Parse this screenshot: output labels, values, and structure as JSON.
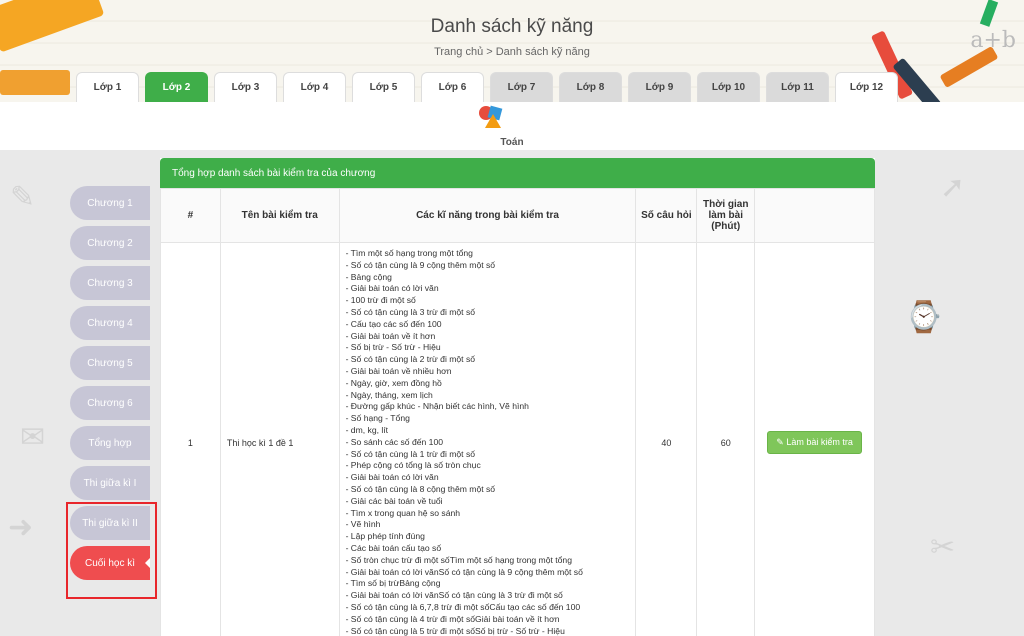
{
  "header": {
    "title": "Danh sách kỹ năng",
    "breadcrumb": "Trang chủ > Danh sách kỹ năng",
    "deco_text": "a+b"
  },
  "grades": [
    {
      "label": "Lớp 1",
      "style": "white"
    },
    {
      "label": "Lớp 2",
      "style": "active"
    },
    {
      "label": "Lớp 3",
      "style": "white"
    },
    {
      "label": "Lớp 4",
      "style": "white"
    },
    {
      "label": "Lớp 5",
      "style": "white"
    },
    {
      "label": "Lớp 6",
      "style": "white"
    },
    {
      "label": "Lớp 7",
      "style": "grey"
    },
    {
      "label": "Lớp 8",
      "style": "grey"
    },
    {
      "label": "Lớp 9",
      "style": "grey"
    },
    {
      "label": "Lớp 10",
      "style": "grey"
    },
    {
      "label": "Lớp 11",
      "style": "grey"
    },
    {
      "label": "Lớp 12",
      "style": "white"
    }
  ],
  "subject": {
    "label": "Toán",
    "icon": "shapes-icon"
  },
  "side_menu": [
    {
      "label": "Chương 1"
    },
    {
      "label": "Chương 2"
    },
    {
      "label": "Chương 3"
    },
    {
      "label": "Chương 4"
    },
    {
      "label": "Chương 5"
    },
    {
      "label": "Chương 6"
    },
    {
      "label": "Tổng hợp"
    },
    {
      "label": "Thi giữa kì I"
    },
    {
      "label": "Thi giữa kì II"
    },
    {
      "label": "Cuối học kì",
      "active": true
    }
  ],
  "panel": {
    "title": "Tổng hợp danh sách bài kiểm tra của chương",
    "columns": [
      "#",
      "Tên bài kiểm tra",
      "Các kĩ năng trong bài kiểm tra",
      "Số câu hỏi",
      "Thời gian làm bài (Phút)",
      ""
    ],
    "rows": [
      {
        "index": "1",
        "name": "Thi học kì 1 đề 1",
        "question_count": "40",
        "duration": "60",
        "action_label": "Làm bài kiểm tra",
        "skills": [
          "- Tìm một số hạng trong một tổng",
          "- Số có tận cùng là 9 cộng thêm một số",
          "- Bảng cộng",
          "- Giải bài toán có lời văn",
          "- 100 trừ đi một số",
          "- Số có tận cùng là 3 trừ đi một số",
          "- Cấu tạo các số đến 100",
          "- Giải bài toán về ít hơn",
          "- Số bị trừ - Số trừ - Hiệu",
          "- Số có tận cùng là 2 trừ đi một số",
          "- Giải bài toán về nhiều hơn",
          "- Ngày, giờ, xem đồng hồ",
          "- Ngày, tháng, xem lịch",
          "- Đường gấp khúc - Nhận biết các hình, Vẽ hình",
          "- Số hạng - Tổng",
          "- dm, kg, lít",
          "- So sánh các số đến 100",
          "- Số có tận cùng là 1 trừ đi một số",
          "- Phép cộng có tổng là số tròn chục",
          "- Giải bài toán có lời văn",
          "- Số có tận cùng là 8 cộng thêm một số",
          "- Giải các bài toán về tuổi",
          "- Tìm x trong quan hệ so sánh",
          "- Vẽ hình",
          "- Lập phép tính đúng",
          "- Các bài toán cấu tạo số",
          "- Số tròn chục trừ đi một sốTìm một số hạng trong một tổng",
          "- Giải bài toán có lời vănSố có tận cùng là 9 cộng thêm một số",
          "- Tìm số bị trừBảng cộng",
          "- Giải bài toán có lời vănSố có tận cùng là 3 trừ đi một số",
          "- Số có tận cùng là 6,7,8 trừ đi một sốCấu tạo các số đến 100",
          "- Số có tận cùng là 4 trừ đi một sốGiải bài toán về ít hơn",
          "- Số có tận cùng là 5 trừ đi một sốSố bị trừ - Số trừ - Hiệu"
        ]
      }
    ]
  }
}
